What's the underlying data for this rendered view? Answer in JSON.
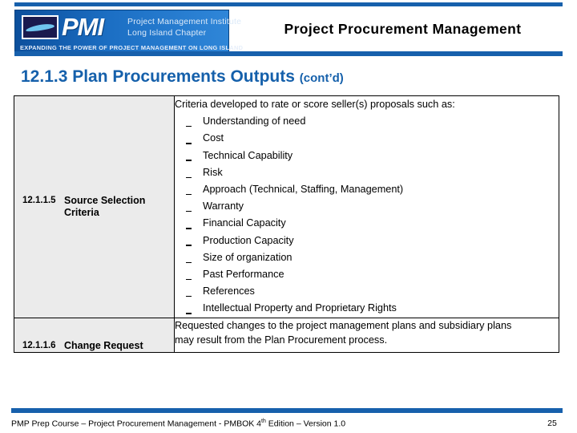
{
  "header": {
    "title": "Project Procurement Management",
    "logo": {
      "wordmark": "PMI",
      "org_line1": "Project Management Institute",
      "org_line2": "Long Island Chapter",
      "tagline": "EXPANDING THE POWER OF PROJECT MANAGEMENT ON LONG ISLAND",
      "mark_icon": "long-island-map-icon"
    },
    "accent_color": "#1760ac"
  },
  "slide": {
    "title": "12.1.3 Plan Procurements Outputs",
    "title_suffix": "(cont’d)",
    "title_color": "#1560ab"
  },
  "table": {
    "cell_fill": "#ebebeb",
    "rows": [
      {
        "code": "12.1.1.5",
        "label": "Source Selection Criteria",
        "intro": "Criteria developed to rate or score seller(s) proposals such as:",
        "bullets": [
          "Understanding of need",
          "Cost",
          "Technical Capability",
          "Risk",
          "Approach (Technical, Staffing, Management)",
          "Warranty",
          "Financial Capacity",
          "Production Capacity",
          "Size of organization",
          "Past Performance",
          "References",
          "Intellectual Property and Proprietary Rights"
        ]
      },
      {
        "code": "12.1.1.6",
        "label": "Change Request",
        "body_line1": "Requested changes to the project management plans and subsidiary plans",
        "body_line2": "may result from the Plan Procurement process."
      }
    ]
  },
  "footer": {
    "text_before_sup": "PMP Prep Course – Project Procurement Management - PMBOK 4",
    "sup": "th",
    "text_after_sup": " Edition – Version 1.0",
    "page_number": "25"
  }
}
